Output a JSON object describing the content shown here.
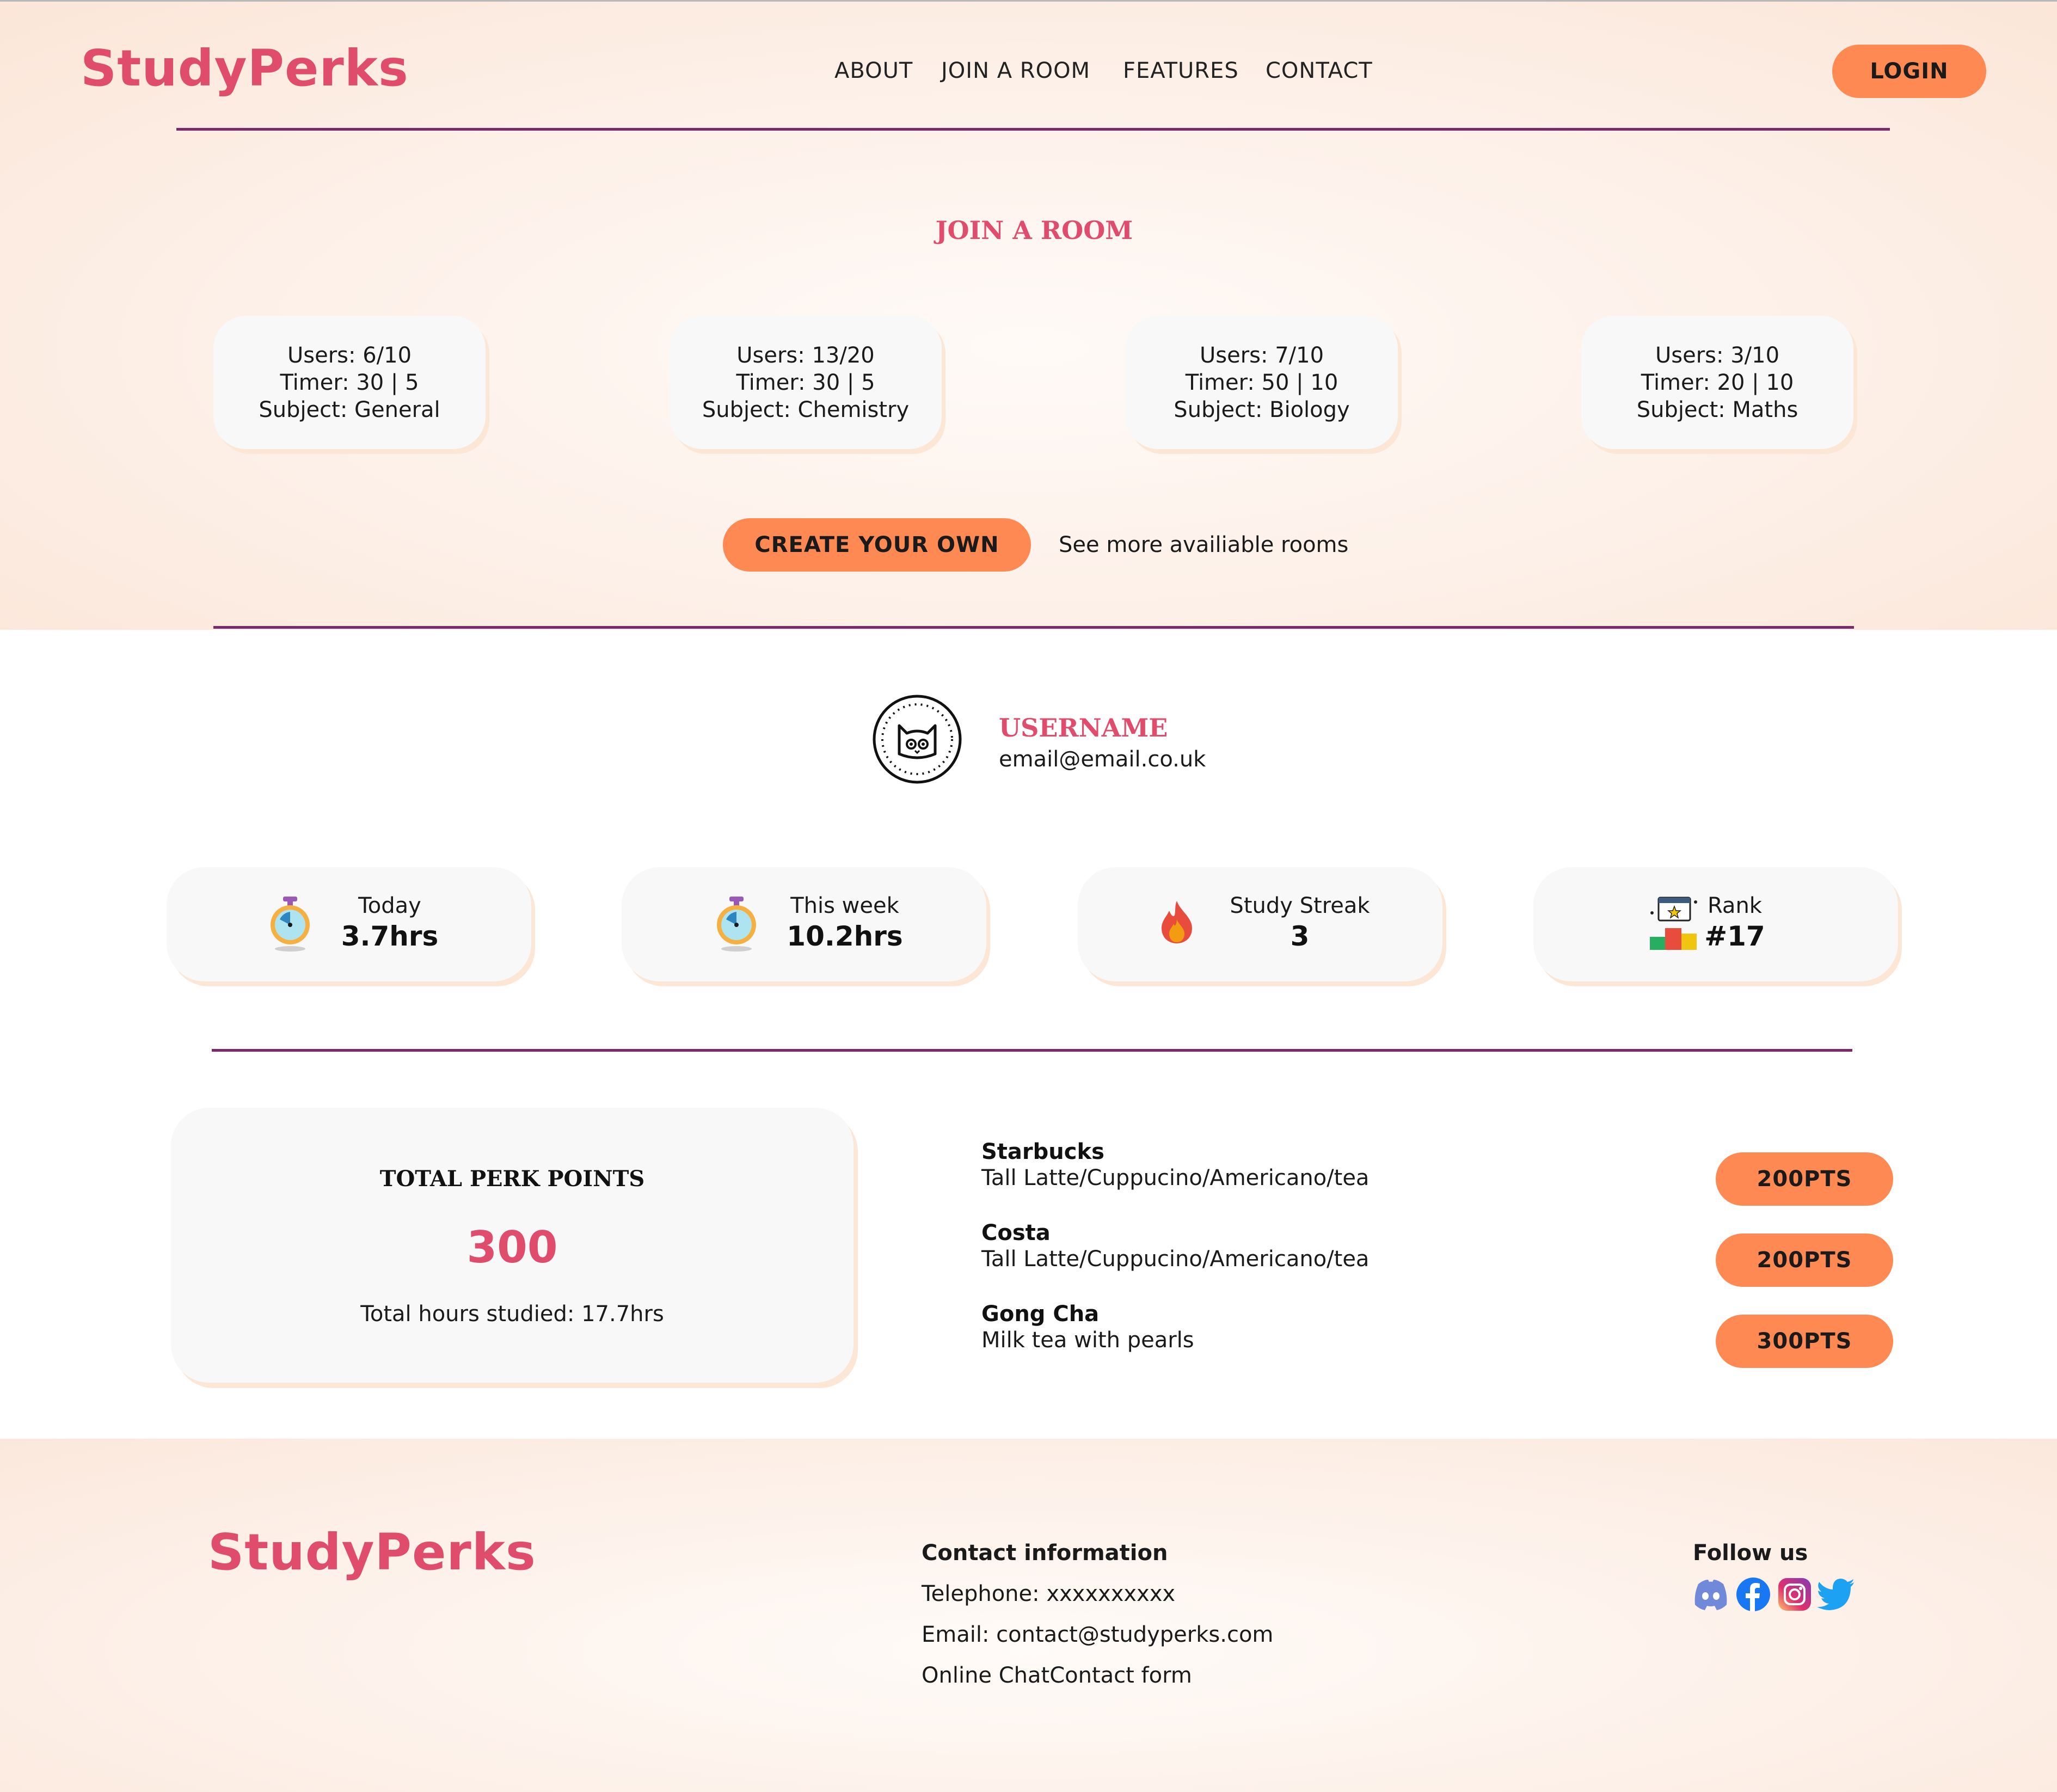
{
  "brand": "StudyPerks",
  "nav": {
    "items": [
      "ABOUT",
      "JOIN A ROOM",
      "FEATURES",
      "CONTACT"
    ],
    "login": "LOGIN"
  },
  "rooms": {
    "title": "JOIN A ROOM",
    "cards": [
      {
        "users": "Users: 6/10",
        "timer": "Timer: 30 | 5",
        "subject": "Subject: General"
      },
      {
        "users": "Users: 13/20",
        "timer": "Timer: 30 | 5",
        "subject": "Subject: Chemistry"
      },
      {
        "users": "Users: 7/10",
        "timer": "Timer: 50 | 10",
        "subject": "Subject: Biology"
      },
      {
        "users": "Users: 3/10",
        "timer": "Timer: 20 | 10",
        "subject": "Subject: Maths"
      }
    ],
    "create_label": "CREATE YOUR OWN",
    "more_link": "See more availiable rooms"
  },
  "profile": {
    "username": "USERNAME",
    "email": "email@email.co.uk",
    "avatar_icon": "cat-avatar-icon"
  },
  "stats": [
    {
      "label": "Today",
      "value": "3.7hrs",
      "icon": "stopwatch-icon"
    },
    {
      "label": "This week",
      "value": "10.2hrs",
      "icon": "stopwatch-icon"
    },
    {
      "label": "Study Streak",
      "value": "3",
      "icon": "fire-icon"
    },
    {
      "label": "Rank",
      "value": "#17",
      "icon": "podium-icon"
    }
  ],
  "perks": {
    "title": "TOTAL PERK POINTS",
    "points": "300",
    "hours": "Total hours studied: 17.7hrs"
  },
  "rewards": [
    {
      "name": "Starbucks",
      "desc": "Tall Latte/Cuppucino/Americano/tea",
      "pts": "200PTS"
    },
    {
      "name": "Costa",
      "desc": "Tall Latte/Cuppucino/Americano/tea",
      "pts": "200PTS"
    },
    {
      "name": "Gong Cha",
      "desc": "Milk tea with pearls",
      "pts": "300PTS"
    }
  ],
  "footer": {
    "brand": "StudyPerks",
    "contact_title": "Contact information",
    "telephone": "Telephone: xxxxxxxxxx",
    "email": "Email: contact@studyperks.com",
    "chat": "Online ChatContact form",
    "follow": "Follow us",
    "social_icons": [
      "discord-icon",
      "facebook-icon",
      "instagram-icon",
      "twitter-icon"
    ]
  },
  "colors": {
    "accent": "#e04c6c",
    "button": "#ff8952",
    "rule": "#7a2a6a",
    "card": "#f8f8f8"
  }
}
